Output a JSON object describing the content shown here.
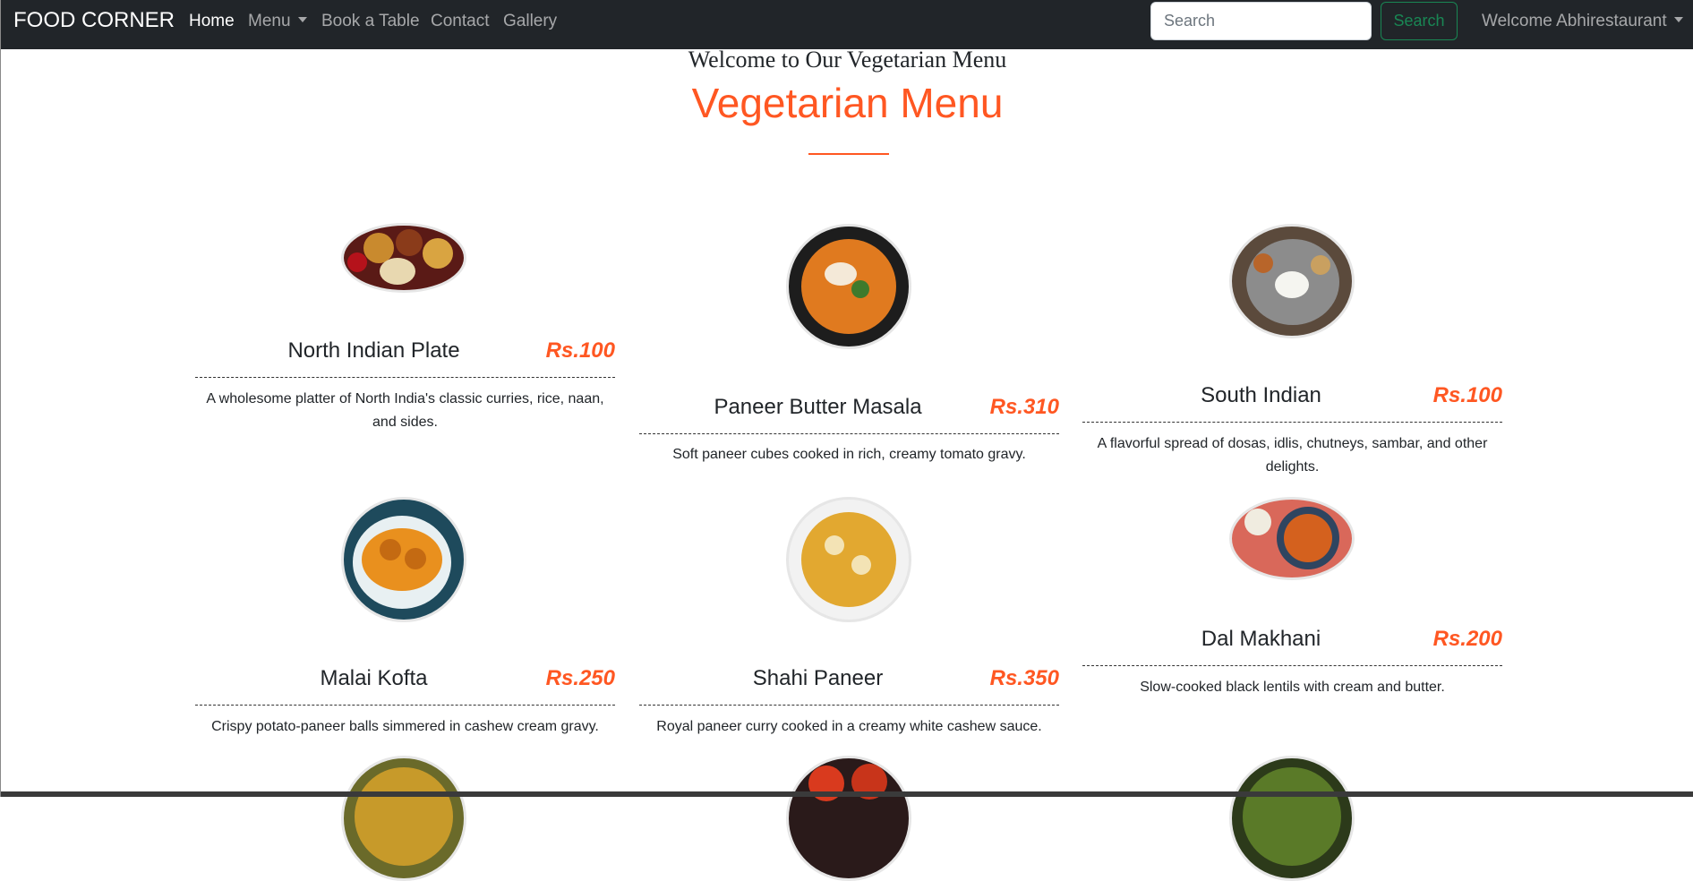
{
  "navbar": {
    "brand": "FOOD CORNER",
    "links": [
      "Home",
      "Menu",
      "Book a Table",
      "Contact",
      "Gallery"
    ],
    "search_placeholder": "Search",
    "search_button": "Search",
    "user_menu": "Welcome Abhirestaurant"
  },
  "page": {
    "welcome": "Welcome to Our Vegetarian Menu",
    "title": "Vegetarian Menu"
  },
  "dishes": [
    {
      "name": "North Indian Plate",
      "price": "Rs.100",
      "description": "A wholesome platter of North India's classic curries, rice, naan, and sides."
    },
    {
      "name": "Paneer Butter Masala",
      "price": "Rs.310",
      "description": "Soft paneer cubes cooked in rich, creamy tomato gravy."
    },
    {
      "name": "South Indian",
      "price": "Rs.100",
      "description": "A flavorful spread of dosas, idlis, chutneys, sambar, and other delights."
    },
    {
      "name": "Malai Kofta",
      "price": "Rs.250",
      "description": "Crispy potato-paneer balls simmered in cashew cream gravy."
    },
    {
      "name": "Shahi Paneer",
      "price": "Rs.350",
      "description": "Royal paneer curry cooked in a creamy white cashew sauce."
    },
    {
      "name": "Dal Makhani",
      "price": "Rs.200",
      "description": "Slow-cooked black lentils with cream and butter."
    }
  ],
  "colors": {
    "accent": "#ff5722",
    "navbar": "#212529",
    "success": "#198754"
  }
}
